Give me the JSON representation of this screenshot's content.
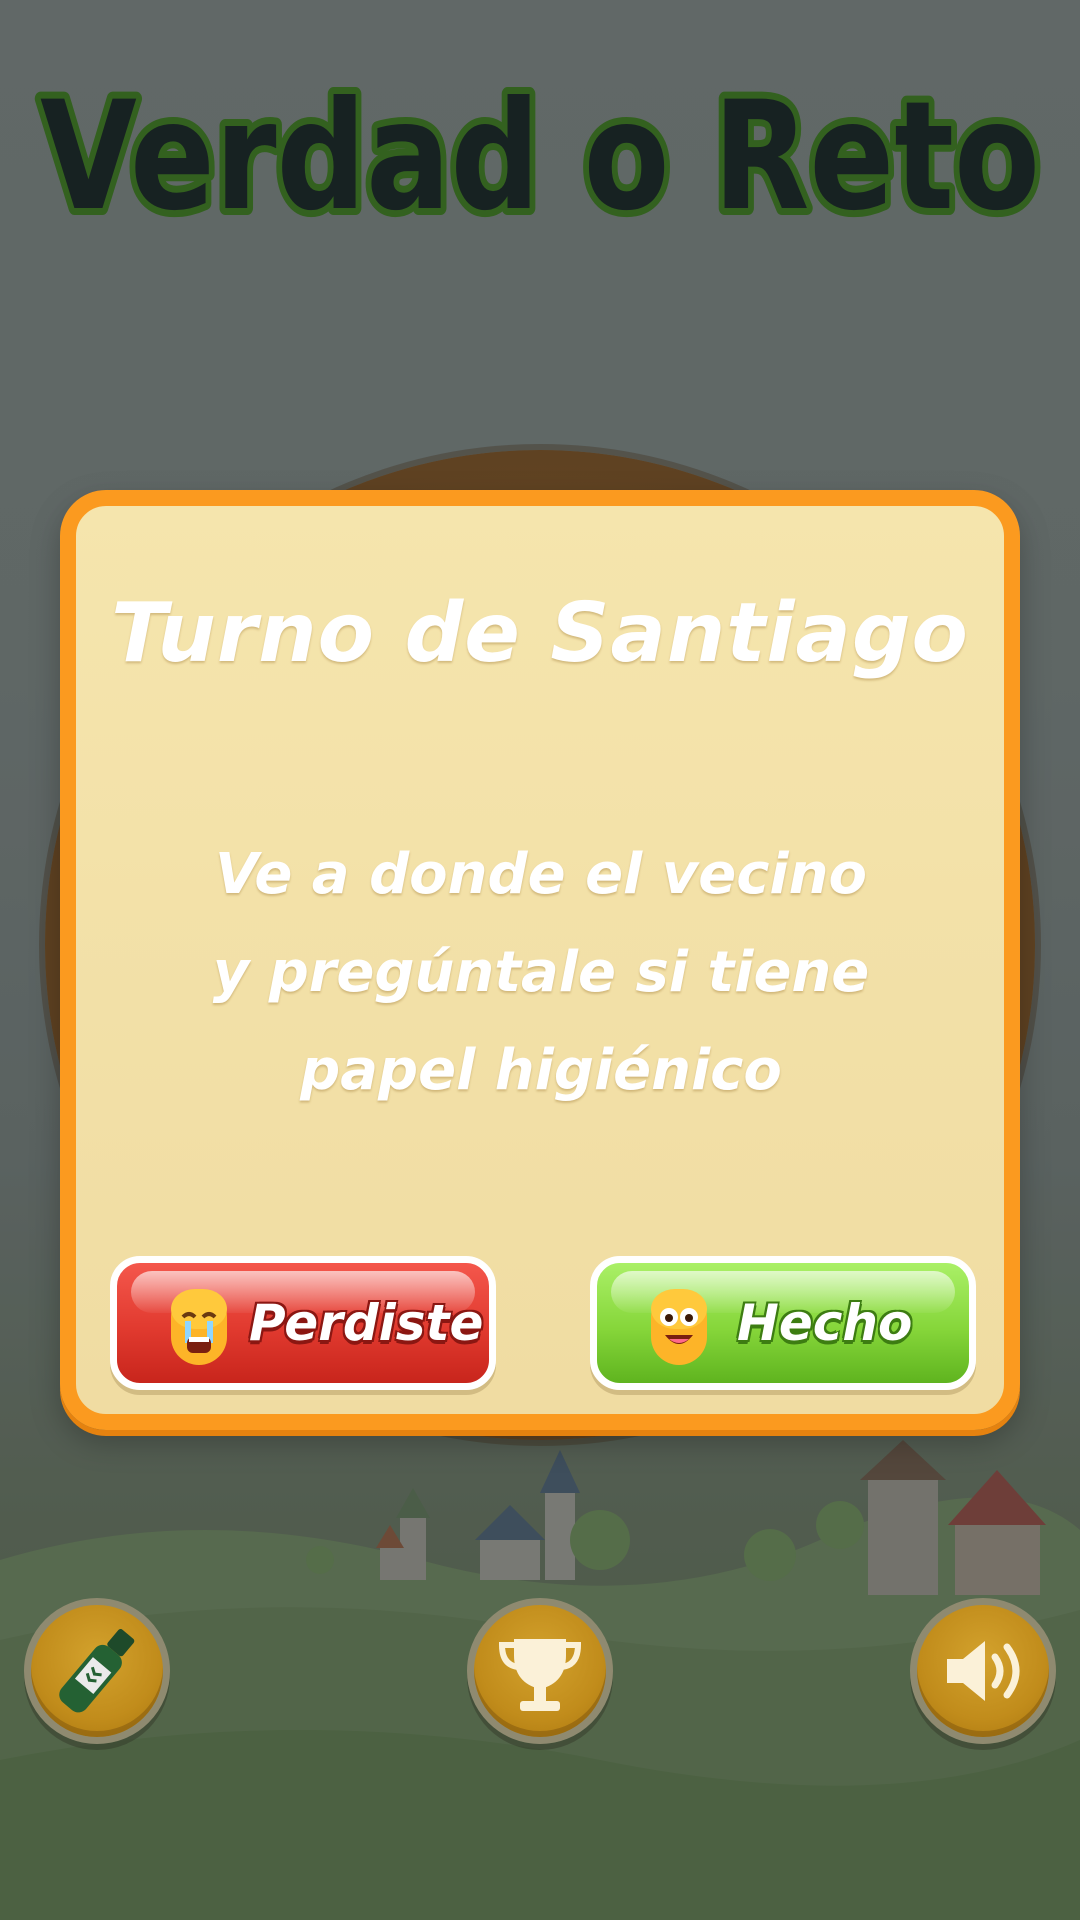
{
  "game": {
    "logo_text": "Verdad o Reto"
  },
  "modal": {
    "title": "Turno de Santiago",
    "message_lines": [
      "Ve a donde el vecino",
      "y pregúntale si tiene",
      "papel higiénico"
    ],
    "lose_button_label": "Perdiste",
    "done_button_label": "Hecho"
  },
  "bottom_bar": {
    "buttons": [
      {
        "name": "bottle",
        "icon": "bottle-icon"
      },
      {
        "name": "trophy",
        "icon": "trophy-icon"
      },
      {
        "name": "sound",
        "icon": "speaker-icon"
      }
    ]
  },
  "colors": {
    "modal_border": "#fb9a1f",
    "modal_fill": "#f3e2a8",
    "lose_button": "#e13a2f",
    "done_button": "#86d63a",
    "round_button": "#c18c1b",
    "logo_fill": "#061312",
    "logo_outline": "#2d6a0e"
  }
}
